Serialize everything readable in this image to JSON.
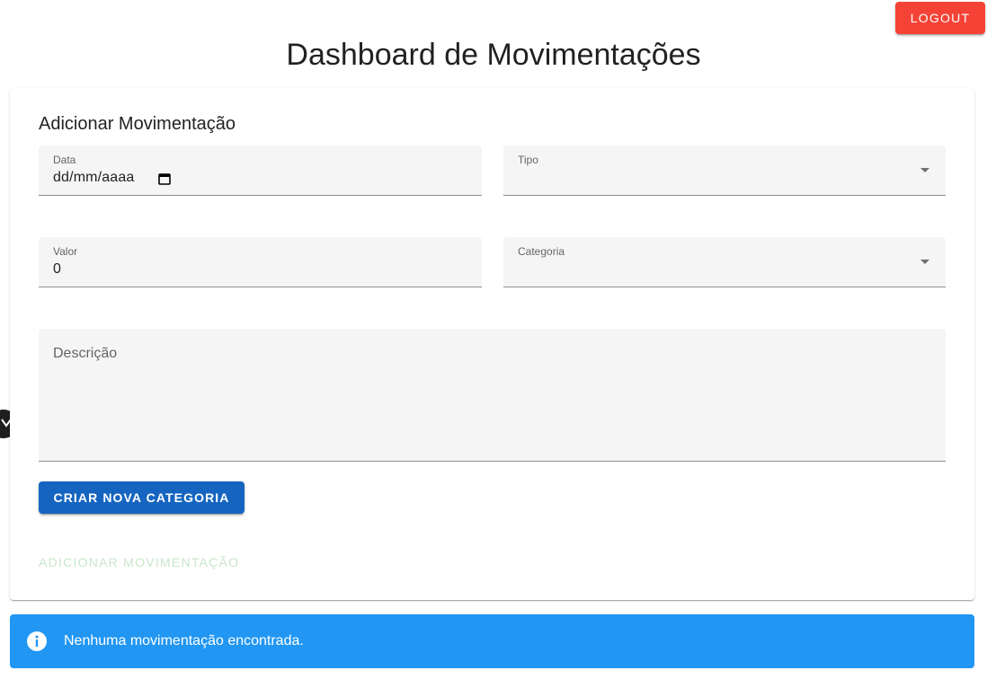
{
  "header": {
    "logout_label": "LOGOUT",
    "title": "Dashboard de Movimentações"
  },
  "form": {
    "title": "Adicionar Movimentação",
    "data": {
      "label": "Data",
      "value": "dd/mm/aaaa"
    },
    "tipo": {
      "label": "Tipo",
      "value": ""
    },
    "valor": {
      "label": "Valor",
      "value": "0"
    },
    "categoria": {
      "label": "Categoria",
      "value": ""
    },
    "descricao": {
      "placeholder": "Descrição"
    },
    "create_category_label": "CRIAR NOVA CATEGORIA",
    "add_label": "ADICIONAR MOVIMENTAÇÃO"
  },
  "alert": {
    "message": "Nenhuma movimentação encontrada.",
    "icon": "info-icon"
  },
  "colors": {
    "logout": "#f44336",
    "primary": "#1565c0",
    "info": "#2196f3",
    "disabled_success": "#c8e6c9"
  }
}
